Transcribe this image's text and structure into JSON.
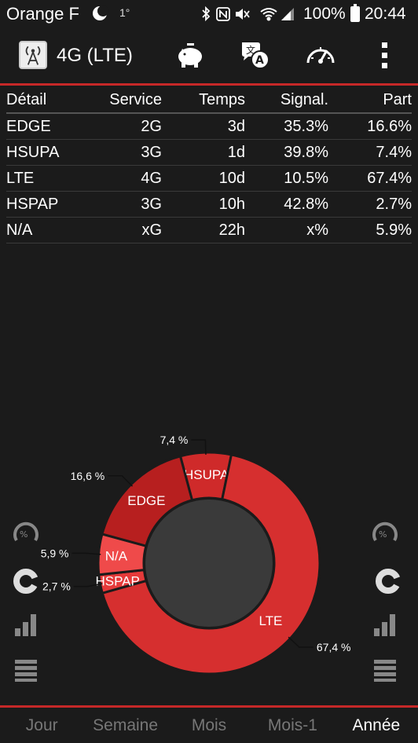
{
  "status": {
    "carrier": "Orange F",
    "temp": "1°",
    "battery": "100%",
    "time": "20:44"
  },
  "appbar": {
    "title": "4G (LTE)",
    "icons": [
      "antenna-icon",
      "piggy-bank-icon",
      "translate-icon",
      "speedometer-icon",
      "more-icon"
    ]
  },
  "table": {
    "headers": [
      "Détail",
      "Service",
      "Temps",
      "Signal.",
      "Part"
    ],
    "rows": [
      [
        "EDGE",
        "2G",
        "3d",
        "35.3%",
        "16.6%"
      ],
      [
        "HSUPA",
        "3G",
        "1d",
        "39.8%",
        "7.4%"
      ],
      [
        "LTE",
        "4G",
        "10d",
        "10.5%",
        "67.4%"
      ],
      [
        "HSPAP",
        "3G",
        "10h",
        "42.8%",
        "2.7%"
      ],
      [
        "N/A",
        "xG",
        "22h",
        "x%",
        "5.9%"
      ]
    ]
  },
  "chart_data": {
    "type": "pie",
    "title": "",
    "categories": [
      "HSUPA",
      "LTE",
      "HSPAP",
      "N/A",
      "EDGE"
    ],
    "values": [
      7.4,
      67.4,
      2.7,
      5.9,
      16.6
    ],
    "value_labels": [
      "7,4 %",
      "67,4 %",
      "2,7 %",
      "5,9 %",
      "16,6 %"
    ],
    "colors": [
      "#cf2a2a",
      "#d62f2f",
      "#e53a3a",
      "#ef4a4a",
      "#b71f1f"
    ],
    "hole_color": "#3a3a3a"
  },
  "side": {
    "left": [
      "percent-gauge-icon",
      "donut-chart-icon",
      "signal-bars-icon",
      "list-icon"
    ],
    "right": [
      "percent-gauge-icon",
      "donut-chart-icon",
      "signal-bars-icon",
      "list-icon"
    ],
    "percent": "%"
  },
  "tabs": [
    {
      "label": "Jour",
      "selected": false
    },
    {
      "label": "Semaine",
      "selected": false
    },
    {
      "label": "Mois",
      "selected": false
    },
    {
      "label": "Mois-1",
      "selected": false
    },
    {
      "label": "Année",
      "selected": true
    }
  ]
}
